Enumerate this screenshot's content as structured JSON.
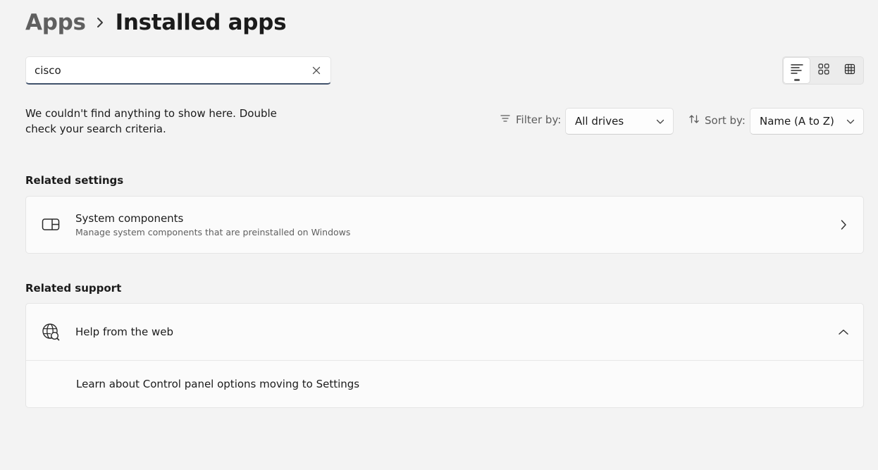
{
  "breadcrumb": {
    "parent": "Apps",
    "current": "Installed apps"
  },
  "search": {
    "value": "cisco",
    "clear_icon": "close-icon"
  },
  "view_modes": [
    {
      "name": "list-view",
      "icon": "list-icon",
      "active": true
    },
    {
      "name": "grid-view",
      "icon": "grid-icon",
      "active": false
    },
    {
      "name": "table-view",
      "icon": "table-icon",
      "active": false
    }
  ],
  "message": "We couldn't find anything to show here. Double check your search criteria.",
  "filter": {
    "label": "Filter by:",
    "value": "All drives",
    "icon": "filter-icon"
  },
  "sort": {
    "label": "Sort by:",
    "value": "Name (A to Z)",
    "icon": "sort-icon"
  },
  "related_settings": {
    "title": "Related settings",
    "items": [
      {
        "title": "System components",
        "subtitle": "Manage system components that are preinstalled on Windows",
        "icon": "system-components-icon"
      }
    ]
  },
  "related_support": {
    "title": "Related support",
    "help": {
      "title": "Help from the web",
      "icon": "globe-help-icon",
      "expanded": true,
      "links": [
        "Learn about Control panel options moving to Settings"
      ]
    }
  },
  "colors": {
    "background": "#f3f3f3",
    "card": "#fbfbfb",
    "search_underline": "#41526b",
    "text": "#1b1b1b",
    "secondary_text": "#5f5f5f"
  }
}
